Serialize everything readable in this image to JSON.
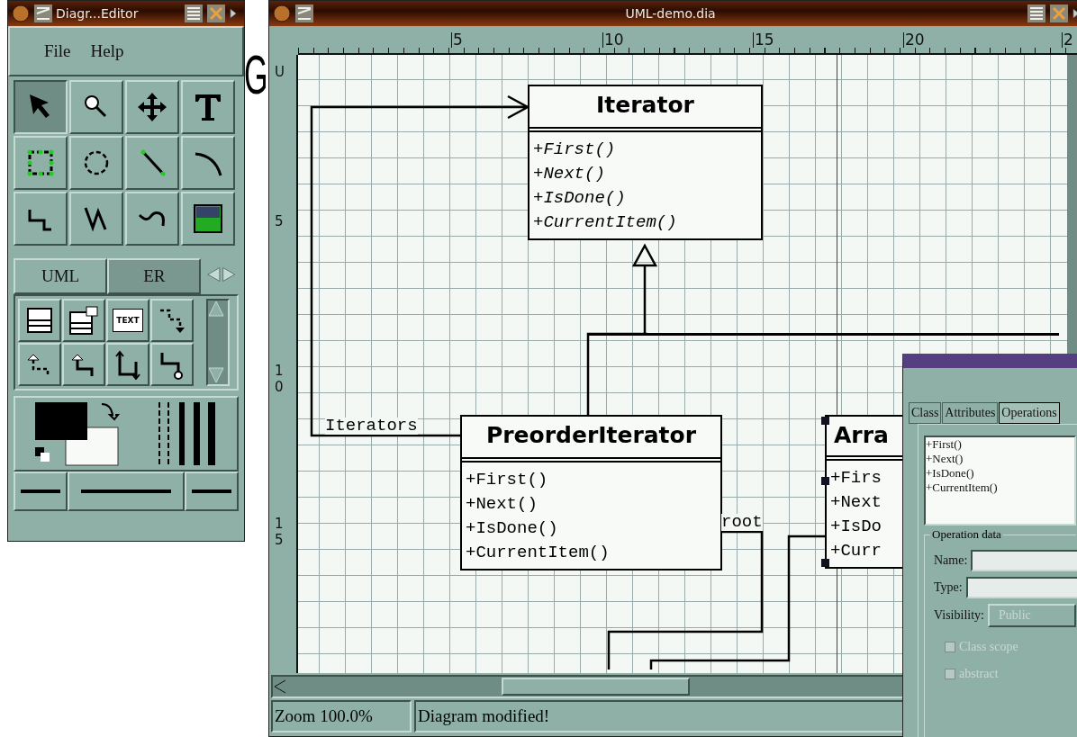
{
  "slide_text": "G",
  "toolbox": {
    "title": "Diagr...Editor",
    "menu": [
      "File",
      "Help"
    ],
    "tools": [
      {
        "kind": "pointer",
        "selected": true
      },
      {
        "kind": "magnify",
        "selected": false
      },
      {
        "kind": "move",
        "selected": false
      },
      {
        "kind": "text",
        "selected": false
      },
      {
        "kind": "box",
        "selected": false
      },
      {
        "kind": "ellipse",
        "selected": false
      },
      {
        "kind": "line",
        "selected": false
      },
      {
        "kind": "arc",
        "selected": false
      },
      {
        "kind": "zigzag",
        "selected": false
      },
      {
        "kind": "polyline",
        "selected": false
      },
      {
        "kind": "bezier",
        "selected": false
      },
      {
        "kind": "image",
        "selected": false
      }
    ],
    "sheet_tabs": [
      {
        "label": "UML",
        "selected": true
      },
      {
        "label": "ER",
        "selected": false
      }
    ],
    "sheet_tools": [
      {
        "kind": "class"
      },
      {
        "kind": "template"
      },
      {
        "kind": "note",
        "label": "TEXT"
      },
      {
        "kind": "dependency"
      },
      {
        "kind": "realizes"
      },
      {
        "kind": "generalization"
      },
      {
        "kind": "association"
      },
      {
        "kind": "implements"
      }
    ]
  },
  "editor": {
    "title": "UML-demo.dia",
    "top_ruler": [
      "5",
      "10",
      "15",
      "20",
      "2"
    ],
    "left_ruler": [
      "U",
      "5",
      "10",
      "15"
    ],
    "classes": [
      {
        "name": "Iterator",
        "abstract": true,
        "selected": false,
        "operations": [
          "+First()",
          "+Next()",
          "+IsDone()",
          "+CurrentItem()"
        ]
      },
      {
        "name": "PreorderIterator",
        "abstract": false,
        "selected": false,
        "operations": [
          "+First()",
          "+Next()",
          "+IsDone()",
          "+CurrentItem()"
        ]
      },
      {
        "name": "Arra",
        "abstract": false,
        "selected": true,
        "operations": [
          "+Firs",
          "+Next",
          "+IsDo",
          "+Curr"
        ]
      }
    ],
    "labels": [
      "Iterators",
      "root"
    ],
    "status": {
      "zoom": "Zoom 100.0%",
      "message": "Diagram modified!"
    }
  },
  "dialog": {
    "tabs": [
      {
        "label": "Class",
        "selected": false
      },
      {
        "label": "Attributes",
        "selected": false
      },
      {
        "label": "Operations",
        "selected": true
      }
    ],
    "operations": [
      "+First()",
      "+Next()",
      "+IsDone()",
      "+CurrentItem()"
    ],
    "group": "Operation data",
    "fields": [
      {
        "label": "Name:"
      },
      {
        "label": "Type:"
      }
    ],
    "visibility": {
      "label": "Visibility:",
      "value": "Public",
      "disabled": true
    },
    "checkboxes": [
      {
        "label": "Class scope",
        "checked": false,
        "disabled": true
      },
      {
        "label": "abstract",
        "checked": false,
        "disabled": true
      }
    ]
  }
}
